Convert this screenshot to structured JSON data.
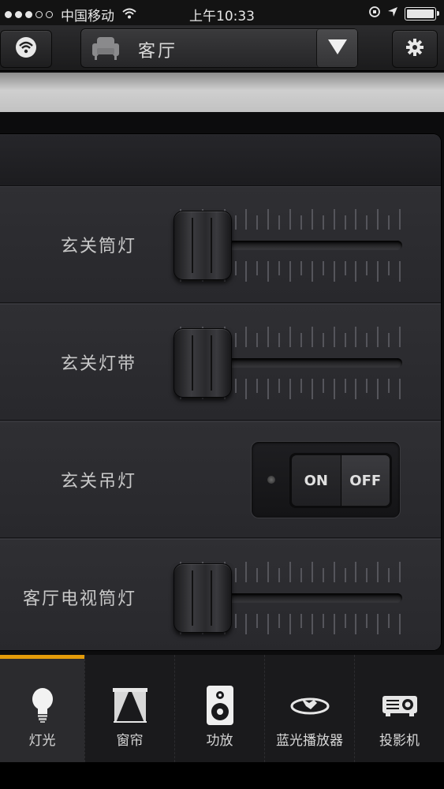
{
  "status_bar": {
    "carrier": "中国移动",
    "time": "上午10:33"
  },
  "header": {
    "room_name": "客厅",
    "icons": {
      "left": "wifi-icon",
      "room": "armchair-icon",
      "dropdown": "triangle-down-icon",
      "right": "gear-icon"
    }
  },
  "controls": [
    {
      "label": "玄关筒灯",
      "type": "slider",
      "level": 0
    },
    {
      "label": "玄关灯带",
      "type": "slider",
      "level": 0
    },
    {
      "label": "玄关吊灯",
      "type": "toggle",
      "on_label": "ON",
      "off_label": "OFF",
      "state": "off"
    },
    {
      "label": "客厅电视筒灯",
      "type": "slider",
      "level": 0
    }
  ],
  "tabs": [
    {
      "label": "灯光",
      "icon": "lightbulb-icon",
      "active": true
    },
    {
      "label": "窗帘",
      "icon": "curtain-icon",
      "active": false
    },
    {
      "label": "功放",
      "icon": "speaker-icon",
      "active": false
    },
    {
      "label": "蓝光播放器",
      "icon": "bluray-icon",
      "active": false
    },
    {
      "label": "投影机",
      "icon": "projector-icon",
      "active": false
    }
  ],
  "colors": {
    "accent": "#e39b0a",
    "background": "#0c0c0d",
    "panel": "#2c2c30"
  }
}
